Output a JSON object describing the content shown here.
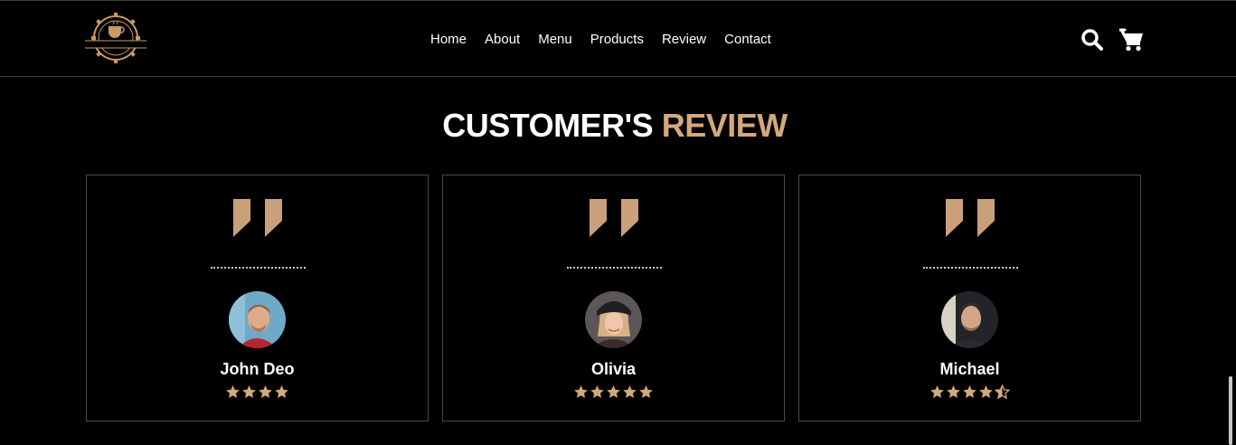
{
  "brand": {
    "logo_text": "CAFENA"
  },
  "nav": {
    "items": [
      {
        "label": "Home"
      },
      {
        "label": "About"
      },
      {
        "label": "Menu"
      },
      {
        "label": "Products"
      },
      {
        "label": "Review"
      },
      {
        "label": "Contact"
      }
    ]
  },
  "header_icons": {
    "search": "search-icon",
    "cart": "shopping-cart-icon"
  },
  "section": {
    "title_main": "CUSTOMER'S",
    "title_accent": "REVIEW"
  },
  "colors": {
    "accent": "#d3a97c",
    "background": "#000000",
    "card_border": "#4a4a4a"
  },
  "reviews": [
    {
      "name": "John Deo",
      "rating": 4
    },
    {
      "name": "Olivia",
      "rating": 5
    },
    {
      "name": "Michael",
      "rating": 4.5
    }
  ]
}
